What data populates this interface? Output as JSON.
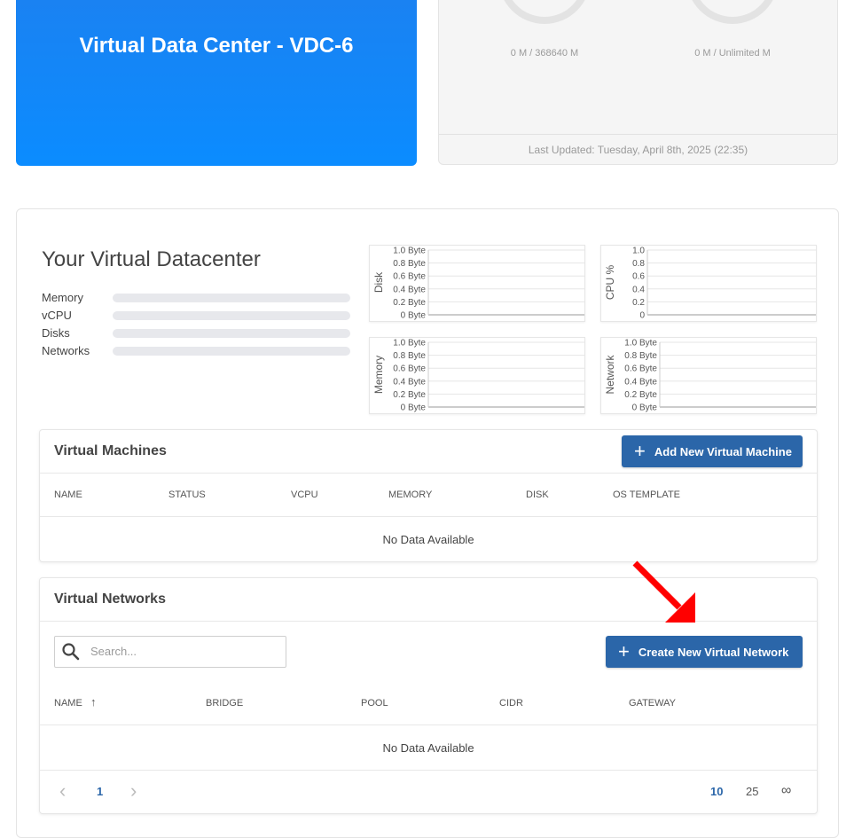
{
  "hero": {
    "title": "Virtual Data Center - VDC-6"
  },
  "stats": {
    "gauges": [
      {
        "value": "0",
        "sub": "0 M / 368640 M"
      },
      {
        "value": "0",
        "sub": "0 M / Unlimited M"
      }
    ],
    "last_updated": "Last Updated: Tuesday, April 8th, 2025 (22:35)"
  },
  "vdc": {
    "heading": "Your Virtual Datacenter",
    "resources": [
      "Memory",
      "vCPU",
      "Disks",
      "Networks"
    ]
  },
  "chart_data": [
    {
      "type": "line",
      "ylabel": "Disk",
      "yticks": [
        "1.0 Byte",
        "0.8 Byte",
        "0.6 Byte",
        "0.4 Byte",
        "0.2 Byte",
        "0 Byte"
      ],
      "ylim": [
        0,
        1
      ],
      "series": []
    },
    {
      "type": "line",
      "ylabel": "CPU %",
      "yticks": [
        "1.0",
        "0.8",
        "0.6",
        "0.4",
        "0.2",
        "0"
      ],
      "ylim": [
        0,
        1
      ],
      "series": []
    },
    {
      "type": "line",
      "ylabel": "Memory",
      "yticks": [
        "1.0 Byte",
        "0.8 Byte",
        "0.6 Byte",
        "0.4 Byte",
        "0.2 Byte",
        "0 Byte"
      ],
      "ylim": [
        0,
        1
      ],
      "series": []
    },
    {
      "type": "line",
      "ylabel": "Network",
      "yticks": [
        "1.0 Byte",
        "0.8 Byte",
        "0.6 Byte",
        "0.4 Byte",
        "0.2 Byte",
        "0 Byte"
      ],
      "ylim": [
        0,
        1
      ],
      "series": []
    }
  ],
  "vms": {
    "title": "Virtual Machines",
    "add_button": "Add New Virtual Machine",
    "columns": [
      "NAME",
      "STATUS",
      "VCPU",
      "MEMORY",
      "DISK",
      "OS TEMPLATE"
    ],
    "empty": "No Data Available"
  },
  "networks": {
    "title": "Virtual Networks",
    "search_placeholder": "Search...",
    "create_button": "Create New Virtual Network",
    "columns": [
      "NAME",
      "BRIDGE",
      "POOL",
      "CIDR",
      "GATEWAY"
    ],
    "sort_indicator": "↑",
    "empty": "No Data Available",
    "pagination": {
      "prev": "‹",
      "page": "1",
      "next": "›",
      "sizes": [
        "10",
        "25",
        "∞"
      ]
    }
  },
  "colors": {
    "primary": "#2b66a9",
    "hero": "#0b8cff",
    "arrow": "#ff0000"
  }
}
